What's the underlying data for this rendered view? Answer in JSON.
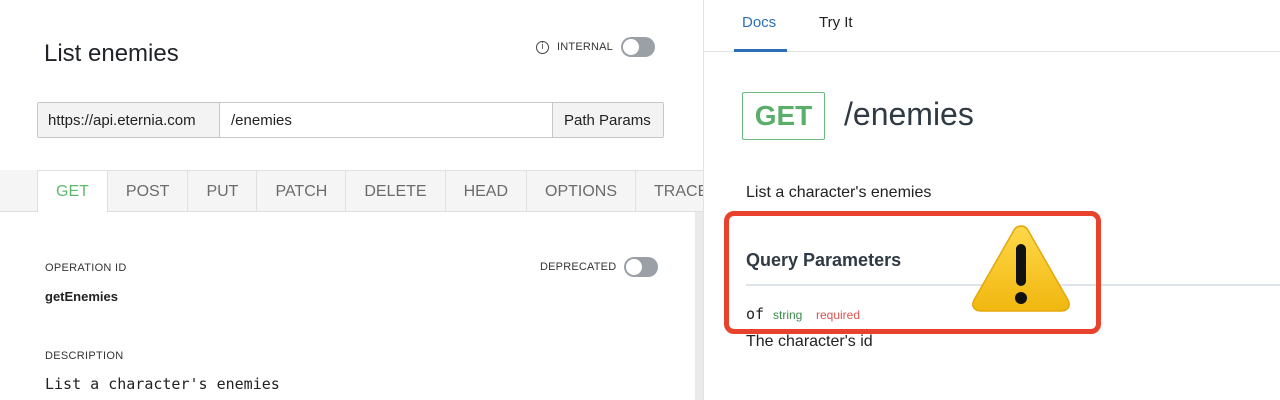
{
  "editor": {
    "title": "List enemies",
    "internal_label": "INTERNAL",
    "url_base": "https://api.eternia.com",
    "url_path": "/enemies",
    "path_params_label": "Path Params",
    "methods": [
      "GET",
      "POST",
      "PUT",
      "PATCH",
      "DELETE",
      "HEAD",
      "OPTIONS",
      "TRACE"
    ],
    "active_method": "GET",
    "operation_id_label": "OPERATION ID",
    "operation_id": "getEnemies",
    "deprecated_label": "DEPRECATED",
    "description_label": "DESCRIPTION",
    "description": "List a character's enemies"
  },
  "preview": {
    "tabs": [
      "Docs",
      "Try It"
    ],
    "active_tab": "Docs",
    "method": "GET",
    "path": "/enemies",
    "description": "List a character's enemies",
    "query_params_title": "Query Parameters",
    "param": {
      "name": "of",
      "type": "string",
      "required_label": "required",
      "description": "The character's id"
    }
  },
  "colors": {
    "get_green": "#5aae6a",
    "tab_blue": "#2c6fb7",
    "highlight_red": "#e8412c",
    "warning_yellow": "#f5c518"
  },
  "icons": {
    "info": "info-icon",
    "warning": "warning-icon"
  }
}
